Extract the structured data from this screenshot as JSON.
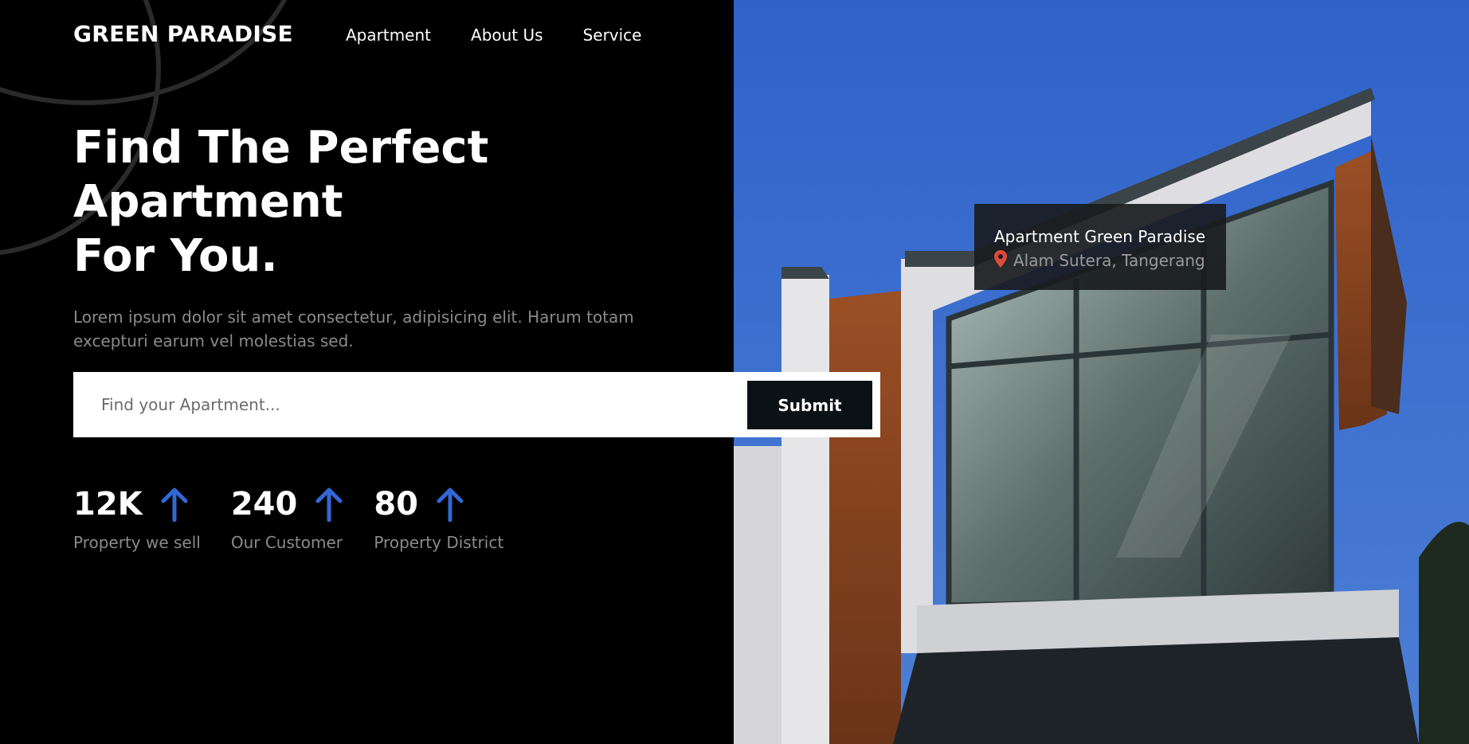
{
  "brand": "GREEN PARADISE",
  "nav": {
    "items": [
      "Apartment",
      "About Us",
      "Service"
    ]
  },
  "hero": {
    "title_lines": [
      "Find The Perfect",
      "Apartment",
      "For You."
    ],
    "description": "Lorem ipsum dolor sit amet consectetur, adipisicing elit. Harum totam excepturi earum vel molestias sed."
  },
  "search": {
    "placeholder": "Find your Apartment...",
    "value": "",
    "submit_label": "Submit"
  },
  "stats": [
    {
      "value": "12K",
      "label": "Property we sell",
      "icon": "arrow-up-icon"
    },
    {
      "value": "240",
      "label": "Our Customer",
      "icon": "arrow-up-icon"
    },
    {
      "value": "80",
      "label": "Property District",
      "icon": "arrow-up-icon"
    }
  ],
  "location_card": {
    "title": "Apartment Green Paradise",
    "address": "Alam Sutera, Tangerang",
    "icon": "map-pin-icon"
  },
  "colors": {
    "background_left": "#000000",
    "accent_arrow": "#3367d6",
    "submit_bg": "#0b1215",
    "pin": "#e04a3a",
    "muted_text": "#8a8a8a"
  }
}
